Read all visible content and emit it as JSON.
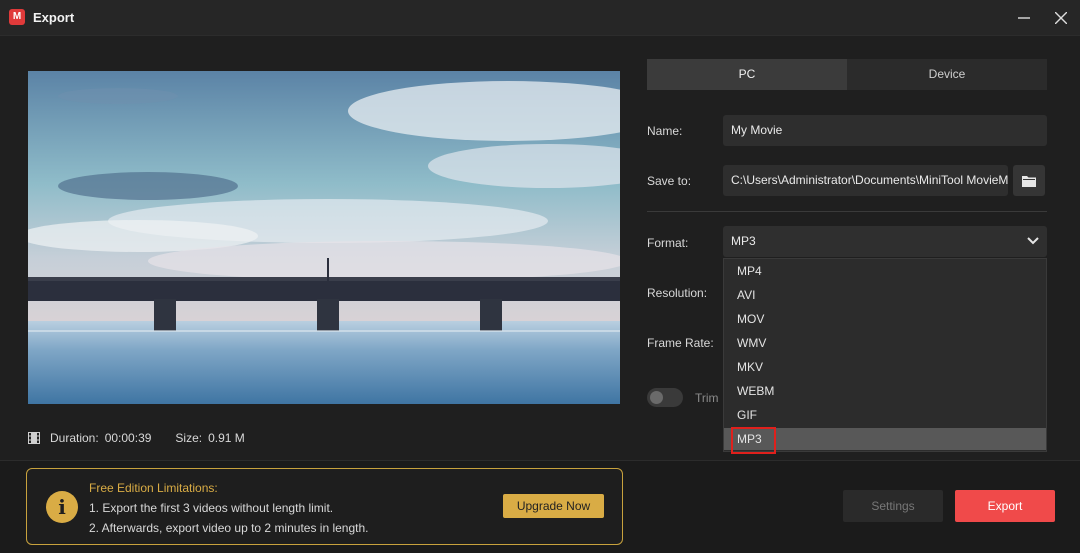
{
  "window": {
    "title": "Export",
    "logo_text": "M",
    "minimize_icon": "minimize-icon",
    "close_icon": "close-icon"
  },
  "preview": {
    "duration_label": "Duration:",
    "duration_value": "00:00:39",
    "size_label": "Size:",
    "size_value": "0.91 M"
  },
  "tabs": [
    {
      "label": "PC",
      "active": true
    },
    {
      "label": "Device",
      "active": false
    }
  ],
  "form": {
    "name_label": "Name:",
    "name_value": "My Movie",
    "save_to_label": "Save to:",
    "save_to_value": "C:\\Users\\Administrator\\Documents\\MiniTool MovieMaker",
    "format_label": "Format:",
    "format_value": "MP3",
    "resolution_label": "Resolution:",
    "frame_rate_label": "Frame Rate:",
    "trim_label": "Trim"
  },
  "format_options": [
    "MP4",
    "AVI",
    "MOV",
    "WMV",
    "MKV",
    "WEBM",
    "GIF",
    "MP3"
  ],
  "selected_format": "MP3",
  "limitations": {
    "title": "Free Edition Limitations:",
    "line1": "1. Export the first 3 videos without length limit.",
    "line2": "2. Afterwards, export video up to 2 minutes in length.",
    "upgrade_label": "Upgrade Now"
  },
  "actions": {
    "settings_label": "Settings",
    "export_label": "Export"
  },
  "colors": {
    "accent_red": "#f04a4a",
    "warning_gold": "#d9ac45",
    "highlight_red": "#e0201c"
  }
}
